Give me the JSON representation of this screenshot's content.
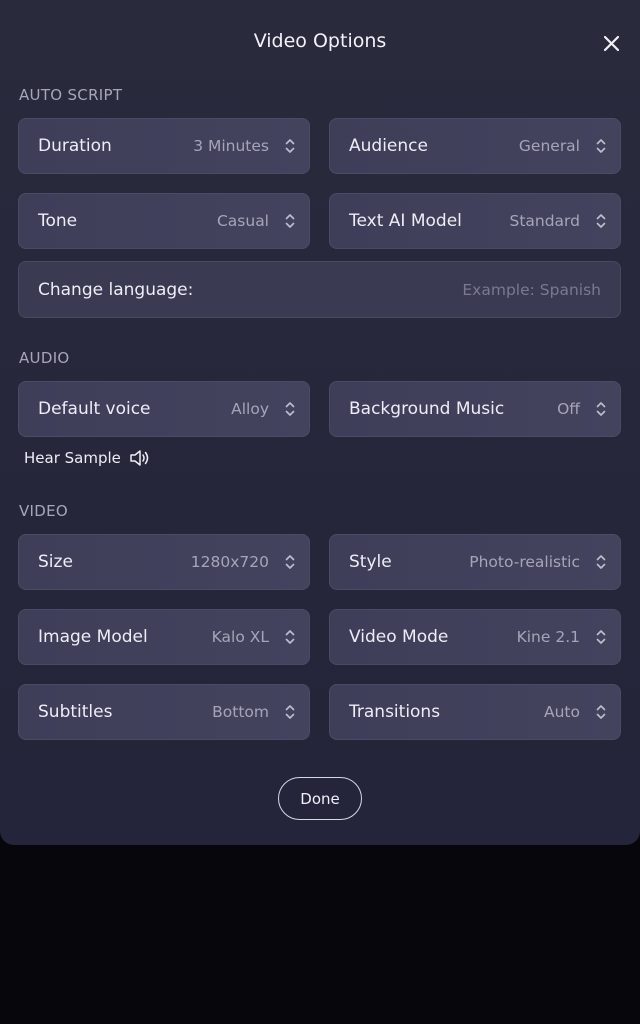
{
  "modal": {
    "title": "Video Options",
    "close_icon": "close-icon"
  },
  "sections": {
    "auto_script": "AUTO SCRIPT",
    "audio": "AUDIO",
    "video": "VIDEO"
  },
  "auto_script": {
    "duration": {
      "label": "Duration",
      "value": "3 Minutes"
    },
    "audience": {
      "label": "Audience",
      "value": "General"
    },
    "tone": {
      "label": "Tone",
      "value": "Casual"
    },
    "text_ai_model": {
      "label": "Text AI Model",
      "value": "Standard"
    },
    "language": {
      "label": "Change language:",
      "placeholder": "Example: Spanish",
      "value": ""
    }
  },
  "audio": {
    "default_voice": {
      "label": "Default voice",
      "value": "Alloy"
    },
    "background_music": {
      "label": "Background Music",
      "value": "Off"
    },
    "hear_sample": {
      "label": "Hear Sample",
      "icon": "speaker-icon"
    }
  },
  "video": {
    "size": {
      "label": "Size",
      "value": "1280x720"
    },
    "style": {
      "label": "Style",
      "value": "Photo-realistic"
    },
    "image_model": {
      "label": "Image Model",
      "value": "Kalo XL"
    },
    "video_mode": {
      "label": "Video Mode",
      "value": "Kine 2.1"
    },
    "subtitles": {
      "label": "Subtitles",
      "value": "Bottom"
    },
    "transitions": {
      "label": "Transitions",
      "value": "Auto"
    }
  },
  "footer": {
    "done_label": "Done"
  },
  "colors": {
    "background": "#07060c",
    "modal": "#2a2a3d",
    "field": "#3e3e59",
    "text": "#eeedf6",
    "muted": "#a6a5b8"
  }
}
